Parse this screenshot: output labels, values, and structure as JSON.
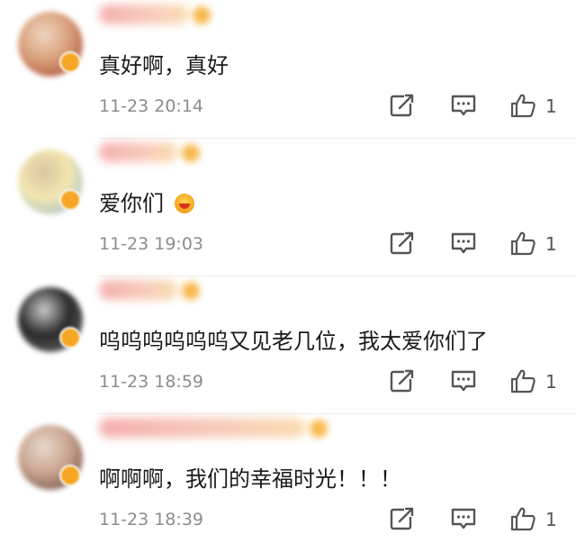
{
  "comments": [
    {
      "text": "真好啊，真好",
      "time": "11-23 20:14",
      "likes": "1",
      "has_emoji": false,
      "name_width": 100,
      "avatar_colors": [
        "#d9a07b",
        "#a03a2c",
        "#f0d5c0"
      ]
    },
    {
      "text": "爱你们",
      "time": "11-23 19:03",
      "likes": "1",
      "has_emoji": true,
      "name_width": 88,
      "avatar_colors": [
        "#f3e6b0",
        "#8fb8d8",
        "#d9c4a0"
      ]
    },
    {
      "text": "呜呜呜呜呜呜又见老几位，我太爱你们了",
      "time": "11-23 18:59",
      "likes": "1",
      "has_emoji": false,
      "name_width": 88,
      "avatar_colors": [
        "#2a2a2a",
        "#7a7a7a",
        "#c9c9c9"
      ]
    },
    {
      "text": "啊啊啊，我们的幸福时光！！！",
      "time": "11-23 18:39",
      "likes": "1",
      "has_emoji": false,
      "name_width": 230,
      "avatar_colors": [
        "#c9a590",
        "#5a3a30",
        "#e8d8cc"
      ]
    }
  ],
  "icons": {
    "share": "share-icon",
    "reply": "reply-icon",
    "like": "thumbs-up-icon",
    "emoji": "heart-eyes-emoji-icon"
  },
  "colors": {
    "text": "#1a1a1a",
    "time": "#8c8c8c",
    "icon": "#555555",
    "verified_badge": "#f5a623"
  }
}
